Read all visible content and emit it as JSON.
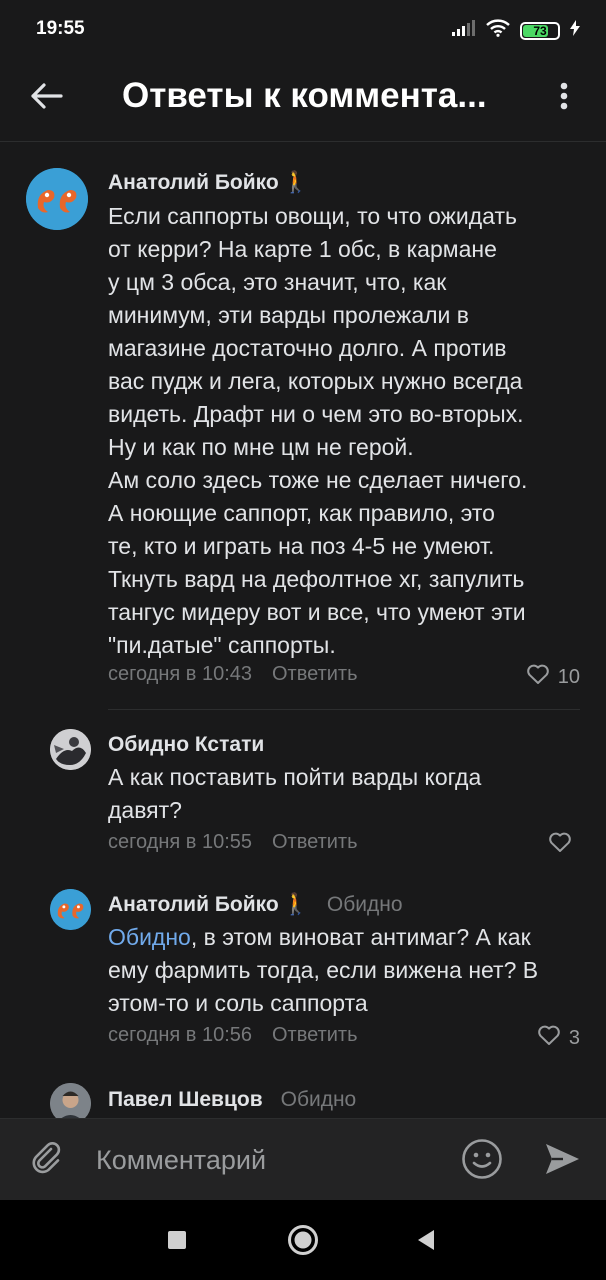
{
  "status_bar": {
    "time": "19:55",
    "battery": "73",
    "battery_level": 0.73
  },
  "header": {
    "title": "Ответы к коммента..."
  },
  "comments": [
    {
      "author": "Анатолий Бойко",
      "author_emoji": "🚶",
      "text": "Если саппорты овощи, то что ожидать\nот керри? На карте 1 обс, в кармане\nу цм 3 обса, это значит, что, как\nминимум, эти варды пролежали в\nмагазине достаточно долго. А против\nвас пудж и лега, которых нужно всегда\nвидеть. Драфт ни о чем это во-вторых.\nНу и как по мне цм не герой.\nАм соло здесь тоже не сделает ничего.\nА ноющие саппорт, как правило, это\nте, кто и играть на поз 4-5 не умеют.\nТкнуть вард на дефолтное хг, запулить\nтангус мидеру вот и все, что умеют эти\n\"пи.датые\" саппорты.",
      "time": "сегодня в 10:43",
      "reply_label": "Ответить",
      "likes": "10"
    },
    {
      "author": "Обидно Кстати",
      "text": "А как поставить пойти варды когда\nдавят?",
      "time": "сегодня в 10:55",
      "reply_label": "Ответить",
      "likes": ""
    },
    {
      "author": "Анатолий Бойко",
      "author_emoji": "🚶",
      "reply_to": "Обидно",
      "mention": "Обидно",
      "text": ", в этом виноват антимаг? А как\nему фармить тогда, если вижена нет? В\nэтом-то и соль саппорта",
      "time": "сегодня в 10:56",
      "reply_label": "Ответить",
      "likes": "3"
    },
    {
      "author": "Павел Шевцов",
      "reply_to": "Обидно"
    }
  ],
  "composer": {
    "placeholder": "Комментарий"
  },
  "colors": {
    "background": "#19191a",
    "accent": "#71aaeb",
    "secondary_text": "#76787a"
  }
}
